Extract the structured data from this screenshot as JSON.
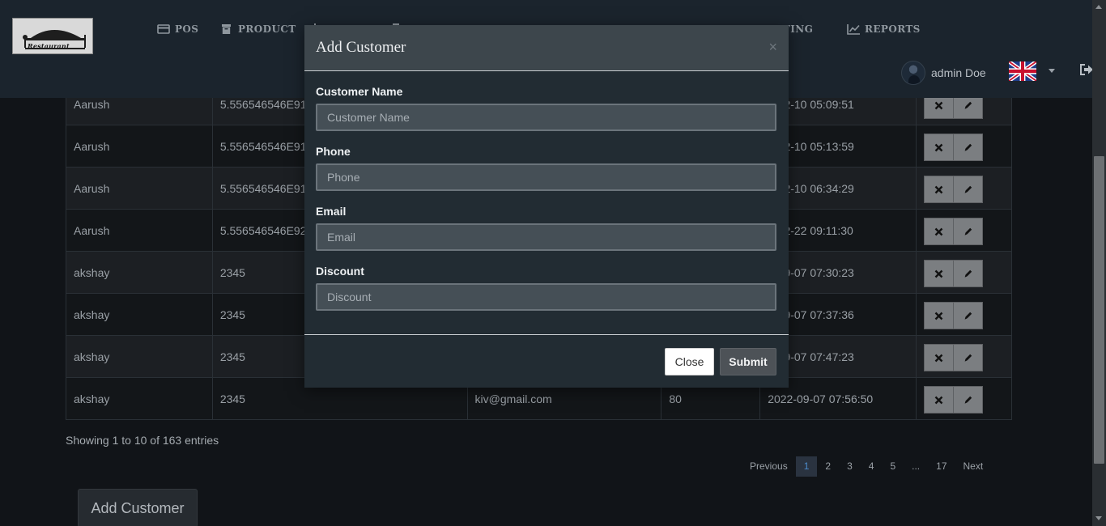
{
  "brand": {
    "logo_text": "Restaurant"
  },
  "nav": {
    "items": [
      {
        "label": "POS",
        "icon": "card-icon"
      },
      {
        "label": "PRODUCT",
        "icon": "archive-icon"
      },
      {
        "label": "TTING",
        "icon": "gear-icon"
      },
      {
        "label": "REPORTS",
        "icon": "line-chart-icon"
      }
    ]
  },
  "user": {
    "name": "admin Doe",
    "language_flag": "uk-flag-icon"
  },
  "table": {
    "rows": [
      {
        "name": "Aarush",
        "phone": "5.556546546E91",
        "email": "",
        "discount": "",
        "date": "2-12-10 05:09:51"
      },
      {
        "name": "Aarush",
        "phone": "5.556546546E91",
        "email": "",
        "discount": "",
        "date": "2-12-10 05:13:59"
      },
      {
        "name": "Aarush",
        "phone": "5.556546546E91",
        "email": "",
        "discount": "",
        "date": "2-12-10 06:34:29"
      },
      {
        "name": "Aarush",
        "phone": "5.556546546E92",
        "email": "",
        "discount": "",
        "date": "2-12-22 09:11:30"
      },
      {
        "name": "akshay",
        "phone": "2345",
        "email": "",
        "discount": "",
        "date": "2-09-07 07:30:23"
      },
      {
        "name": "akshay",
        "phone": "2345",
        "email": "",
        "discount": "",
        "date": "2-09-07 07:37:36"
      },
      {
        "name": "akshay",
        "phone": "2345",
        "email": "",
        "discount": "",
        "date": "2-09-07 07:47:23"
      },
      {
        "name": "akshay",
        "phone": "2345",
        "email": "kiv@gmail.com",
        "discount": "80",
        "date": "2022-09-07 07:56:50"
      }
    ]
  },
  "footer": {
    "entries_text": "Showing 1 to 10 of 163 entries",
    "pagination": {
      "previous": "Previous",
      "pages": [
        "1",
        "2",
        "3",
        "4",
        "5",
        "...",
        "17"
      ],
      "active_page": "1",
      "next": "Next"
    },
    "add_button": "Add Customer"
  },
  "modal": {
    "title": "Add Customer",
    "close_symbol": "×",
    "fields": [
      {
        "label": "Customer Name",
        "placeholder": "Customer Name",
        "value": ""
      },
      {
        "label": "Phone",
        "placeholder": "Phone",
        "value": ""
      },
      {
        "label": "Email",
        "placeholder": "Email",
        "value": ""
      },
      {
        "label": "Discount",
        "placeholder": "Discount",
        "value": ""
      }
    ],
    "close_button": "Close",
    "submit_button": "Submit"
  },
  "colors": {
    "navbar": "#1b242d",
    "page_bg": "#111418",
    "modal_header": "#3d464c",
    "modal_body": "#222c33",
    "action_button": "#7b7e81",
    "active_page": "#4b8ac9"
  }
}
